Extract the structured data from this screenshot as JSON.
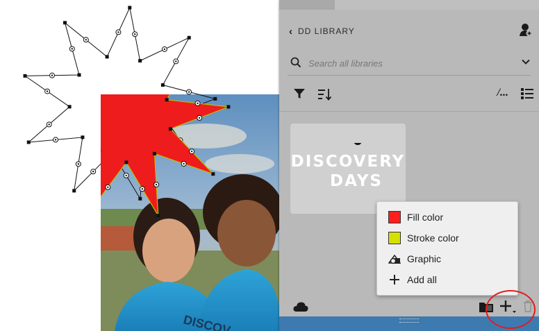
{
  "panel": {
    "back_chevron": "‹",
    "library_title": "DD LIBRARY",
    "search": {
      "placeholder": "Search all libraries",
      "value": ""
    },
    "view_label": "/...",
    "asset": {
      "logo_line1": "DISCOVERY",
      "logo_line2": "DAYS",
      "logo_color": "#ffffff",
      "tile_color": "#d0d0d0"
    }
  },
  "add_menu": {
    "items": [
      {
        "label": "Fill color",
        "icon": "fill-swatch-icon",
        "swatch": "#ff1e1e"
      },
      {
        "label": "Stroke color",
        "icon": "stroke-swatch-icon",
        "swatch": "#d4e000"
      },
      {
        "label": "Graphic",
        "icon": "graphic-shapes-icon"
      },
      {
        "label": "Add all",
        "icon": "plus-icon"
      }
    ]
  },
  "canvas": {
    "star_fill": "#ee1c1c",
    "star_stroke": "#b8c000",
    "outline_stroke": "#111111",
    "photo_shirt_text": "DISCOV"
  },
  "colors": {
    "highlight": "#e01e1e",
    "panel_bg": "#b9b9b9"
  }
}
